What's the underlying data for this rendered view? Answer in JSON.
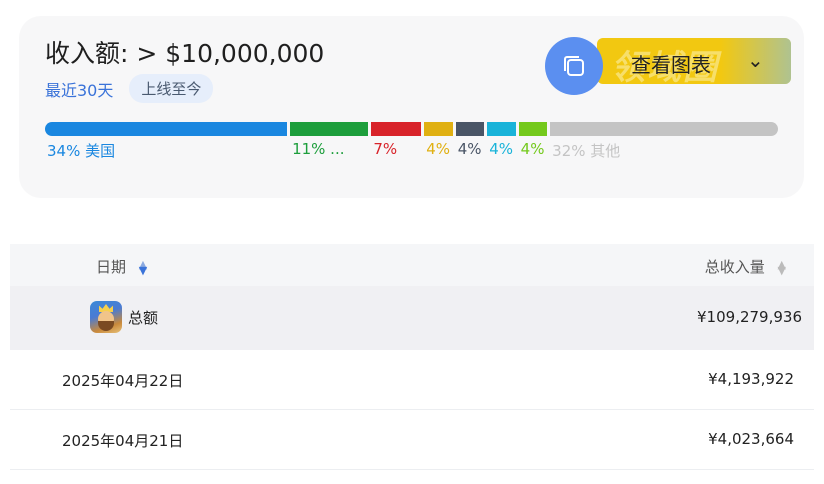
{
  "summary": {
    "title": "收入额: > $10,000,000",
    "range_active": "最近30天",
    "range_other": "上线至今",
    "chart_button_label": "查看图表",
    "watermark": "领域圈"
  },
  "share_bar": [
    {
      "pct": 34,
      "label": "34% 美国",
      "color": "#1a87e0"
    },
    {
      "pct": 11,
      "label": "11% ...",
      "color": "#1d9e3c"
    },
    {
      "pct": 7,
      "label": "7%",
      "color": "#d8232a"
    },
    {
      "pct": 4,
      "label": "4%",
      "color": "#e0b012"
    },
    {
      "pct": 4,
      "label": "4%",
      "color": "#4a5566"
    },
    {
      "pct": 4,
      "label": "4%",
      "color": "#19b3d9"
    },
    {
      "pct": 4,
      "label": "4%",
      "color": "#74c91c"
    },
    {
      "pct": 32,
      "label": "32% 其他",
      "color": "#c4c4c4"
    }
  ],
  "table": {
    "col_date": "日期",
    "col_revenue": "总收入量",
    "total_label": "总额",
    "total_value": "¥109,279,936",
    "rows": [
      {
        "date": "2025年04月22日",
        "value": "¥4,193,922"
      },
      {
        "date": "2025年04月21日",
        "value": "¥4,023,664"
      }
    ]
  }
}
